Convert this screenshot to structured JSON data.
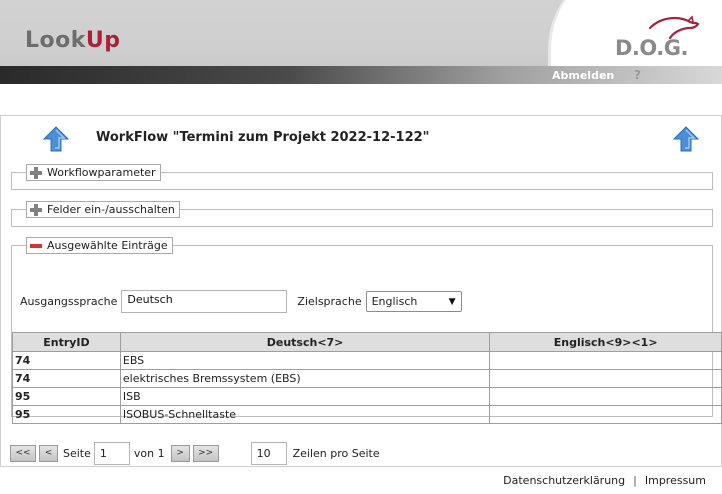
{
  "header": {
    "logo_part1": "Look",
    "logo_part2": "Up",
    "company_logo": "D.O.G.",
    "logout_label": "Abmelden",
    "help_label": "?",
    "colors": {
      "brand_red": "#a8233a",
      "header_grey": "#cfcfcf"
    }
  },
  "workflow": {
    "title": "WorkFlow \"Termini zum Projekt 2022-12-122\"",
    "icons": [
      "up-arrow-icon",
      "up-arrow-icon"
    ]
  },
  "sections": {
    "params_label": "Workflowparameter",
    "fields_label": "Felder ein-/ausschalten",
    "selected_label": "Ausgewählte Einträge"
  },
  "languages": {
    "source_label": "Ausgangssprache",
    "source_value": "Deutsch",
    "target_label": "Zielsprache",
    "target_value": "Englisch"
  },
  "table": {
    "columns": [
      "EntryID",
      "Deutsch<7>",
      "Englisch<9><1>"
    ],
    "rows": [
      {
        "id": "74",
        "de": "EBS",
        "en": ""
      },
      {
        "id": "74",
        "de": "elektrisches Bremssystem (EBS)",
        "en": ""
      },
      {
        "id": "95",
        "de": "ISB",
        "en": ""
      },
      {
        "id": "95",
        "de": "ISOBUS-Schnelltaste",
        "en": ""
      }
    ]
  },
  "pager": {
    "first_label": "<<",
    "prev_label": "<",
    "page_label": "Seite",
    "page_value": "1",
    "of_label": "von 1",
    "next_label": ">",
    "last_label": ">>",
    "rows_value": "10",
    "rows_label": "Zeilen pro Seite"
  },
  "footer": {
    "privacy_label": "Datenschutzerklärung",
    "separator": "|",
    "imprint_label": "Impressum"
  }
}
